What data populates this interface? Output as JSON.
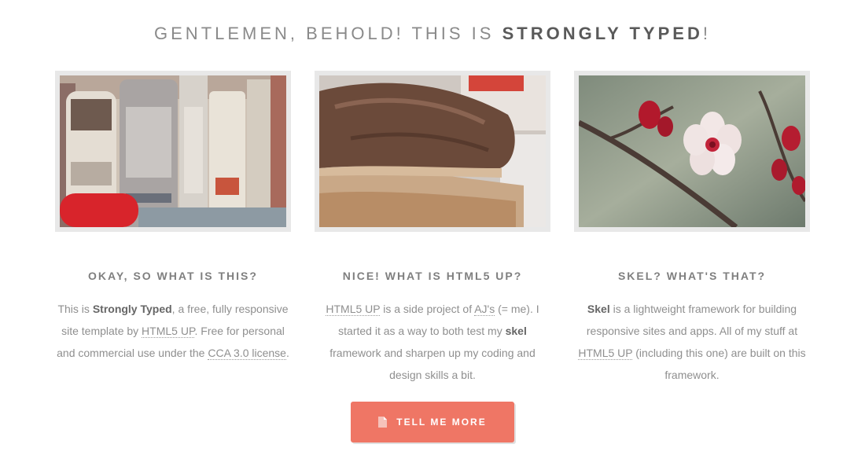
{
  "headline": {
    "prefix": "GENTLEMEN, BEHOLD! THIS IS ",
    "bold": "STRONGLY TYPED",
    "suffix": "!"
  },
  "features": [
    {
      "title": "OKAY, SO WHAT IS THIS?",
      "image": "books-photo",
      "text": {
        "t1": "This is ",
        "b1": "Strongly Typed",
        "t2": ", a free, fully responsive site template by ",
        "l1": "HTML5 UP",
        "t3": ". Free for personal and commercial use under the ",
        "l2": "CCA 3.0 license",
        "t4": "."
      }
    },
    {
      "title": "NICE! WHAT IS HTML5 UP?",
      "image": "toast-photo",
      "text": {
        "l1": "HTML5 UP",
        "t1": " is a side project of ",
        "l2": "AJ's",
        "t2": " (= me). I started it as a way to both test my ",
        "b1": "skel",
        "t3": " framework and sharpen up my coding and design skills a bit."
      }
    },
    {
      "title": "SKEL? WHAT'S THAT?",
      "image": "blossom-photo",
      "text": {
        "b1": "Skel",
        "t1": " is a lightweight framework for building responsive sites and apps. All of my stuff at ",
        "l1": "HTML5 UP",
        "t2": " (including this one) are built on this framework."
      }
    }
  ],
  "button": {
    "label": "TELL ME MORE",
    "icon": "document-icon",
    "color": "#ef7665"
  }
}
